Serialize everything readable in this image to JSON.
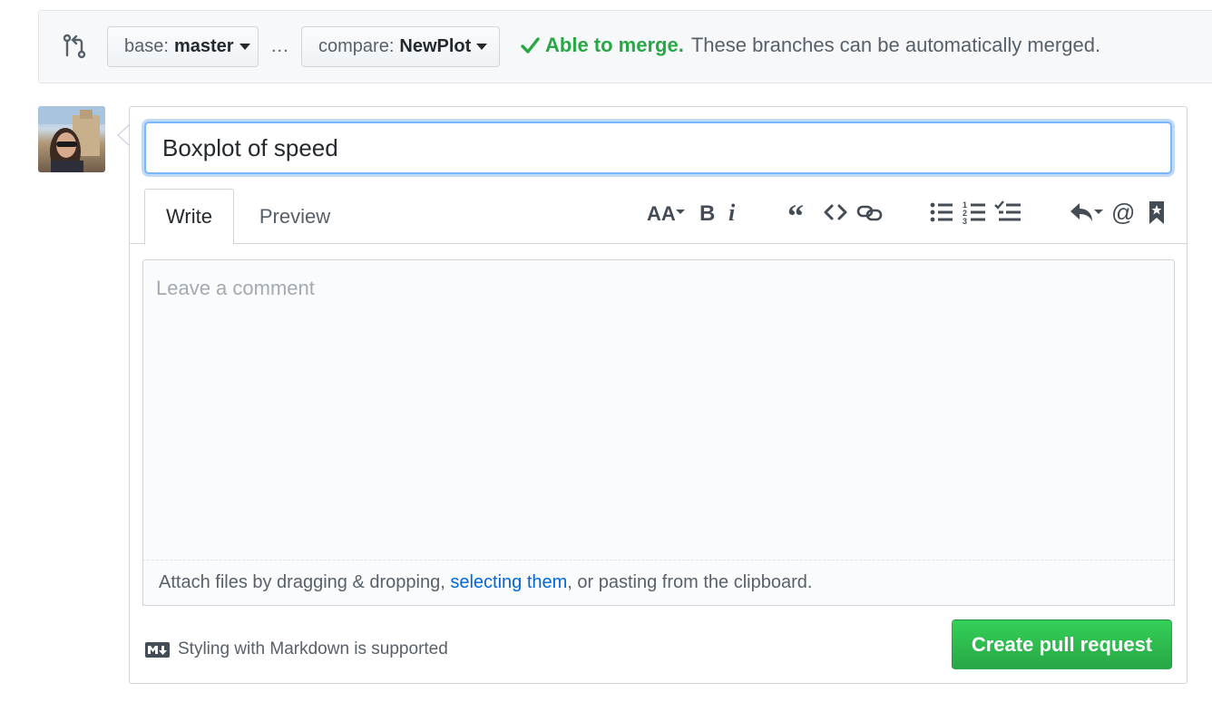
{
  "compare_bar": {
    "base_label": "base:",
    "base_value": "master",
    "separator": "...",
    "compare_label": "compare:",
    "compare_value": "NewPlot",
    "merge_ok": "Able to merge.",
    "merge_message": "These branches can be automatically merged."
  },
  "pr_form": {
    "title_value": "Boxplot of speed",
    "tabs": {
      "write": "Write",
      "preview": "Preview"
    },
    "toolbar": [
      "header-icon",
      "bold-icon",
      "italic-icon",
      "quote-icon",
      "code-icon",
      "link-icon",
      "bullet-list-icon",
      "numbered-list-icon",
      "task-list-icon",
      "reply-icon",
      "mention-icon",
      "bookmark-icon"
    ],
    "comment_placeholder": "Leave a comment",
    "attach": {
      "prefix": "Attach files by dragging & dropping,",
      "link": "selecting them",
      "suffix": ", or pasting from the clipboard."
    },
    "markdown_note": "Styling with Markdown is supported",
    "submit_label": "Create pull request"
  },
  "colors": {
    "success": "#28a745",
    "link": "#0366d6",
    "focus": "#79b8ff"
  }
}
